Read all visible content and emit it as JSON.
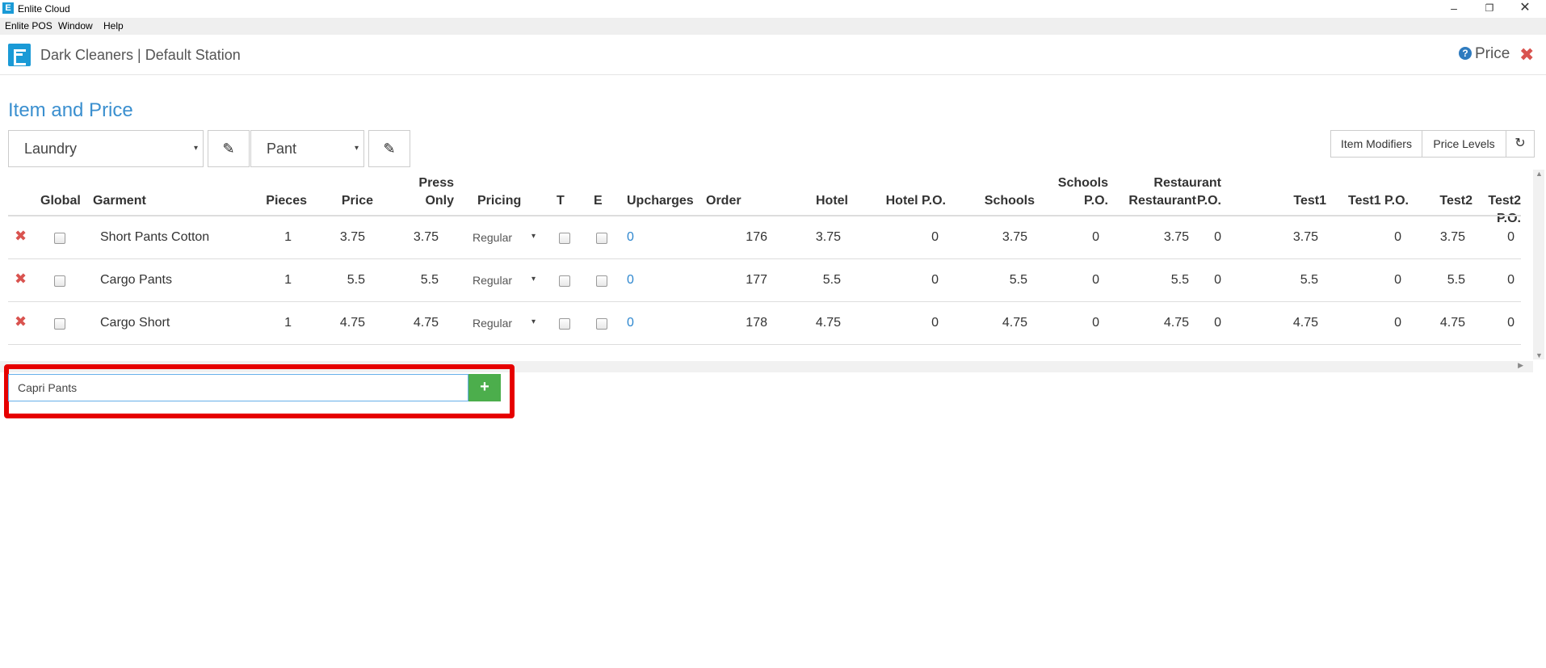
{
  "window": {
    "logo_letter": "E",
    "title": "Enlite Cloud",
    "minimize_icon": "–",
    "restore_icon": "❐",
    "close_icon": "✕"
  },
  "menu": [
    "Enlite POS",
    "Window",
    "Help"
  ],
  "header": {
    "station": "Dark Cleaners | Default Station",
    "help_label": "Price",
    "help_icon_glyph": "?",
    "close_glyph": "✖"
  },
  "page": {
    "heading": "Item and Price",
    "category_select": "Laundry",
    "type_select": "Pant",
    "edit_glyph": "✎",
    "caret": "▾",
    "buttons": {
      "item_modifiers": "Item Modifiers",
      "price_levels": "Price Levels",
      "refresh_glyph": "↻"
    }
  },
  "table": {
    "headers": {
      "global": "Global",
      "garment": "Garment",
      "pieces": "Pieces",
      "price": "Price",
      "press_only_1": "Press",
      "press_only_2": "Only",
      "pricing": "Pricing",
      "t": "T",
      "e": "E",
      "upcharges": "Upcharges",
      "order": "Order",
      "hotel": "Hotel",
      "hotel_po": "Hotel P.O.",
      "schools": "Schools",
      "schools_po_1": "Schools",
      "schools_po_2": "P.O.",
      "restaurant": "Restaurant",
      "restaurant_po_1": "Restaurant",
      "restaurant_po_2": "P.O.",
      "test1": "Test1",
      "test1_po": "Test1 P.O.",
      "test2": "Test2",
      "test2_po": "Test2 P.O."
    },
    "delete_glyph": "✖",
    "rows": [
      {
        "garment": "Short Pants Cotton",
        "pieces": "1",
        "price": "3.75",
        "press_only": "3.75",
        "pricing": "Regular",
        "upcharges": "0",
        "order": "176",
        "hotel": "3.75",
        "hotel_po": "0",
        "schools": "3.75",
        "schools_po": "0",
        "restaurant": "3.75",
        "restaurant_po": "0",
        "test1": "3.75",
        "test1_po": "0",
        "test2": "3.75",
        "test2_po": "0"
      },
      {
        "garment": "Cargo Pants",
        "pieces": "1",
        "price": "5.5",
        "press_only": "5.5",
        "pricing": "Regular",
        "upcharges": "0",
        "order": "177",
        "hotel": "5.5",
        "hotel_po": "0",
        "schools": "5.5",
        "schools_po": "0",
        "restaurant": "5.5",
        "restaurant_po": "0",
        "test1": "5.5",
        "test1_po": "0",
        "test2": "5.5",
        "test2_po": "0"
      },
      {
        "garment": "Cargo Short",
        "pieces": "1",
        "price": "4.75",
        "press_only": "4.75",
        "pricing": "Regular",
        "upcharges": "0",
        "order": "178",
        "hotel": "4.75",
        "hotel_po": "0",
        "schools": "4.75",
        "schools_po": "0",
        "restaurant": "4.75",
        "restaurant_po": "0",
        "test1": "4.75",
        "test1_po": "0",
        "test2": "4.75",
        "test2_po": "0"
      }
    ]
  },
  "add_item": {
    "value": "Capri Pants",
    "button_glyph": "+"
  },
  "colors": {
    "accent": "#3a8fcf",
    "delete": "#d9534f",
    "add_button": "#4cae4c",
    "highlight_frame": "#e60000"
  }
}
